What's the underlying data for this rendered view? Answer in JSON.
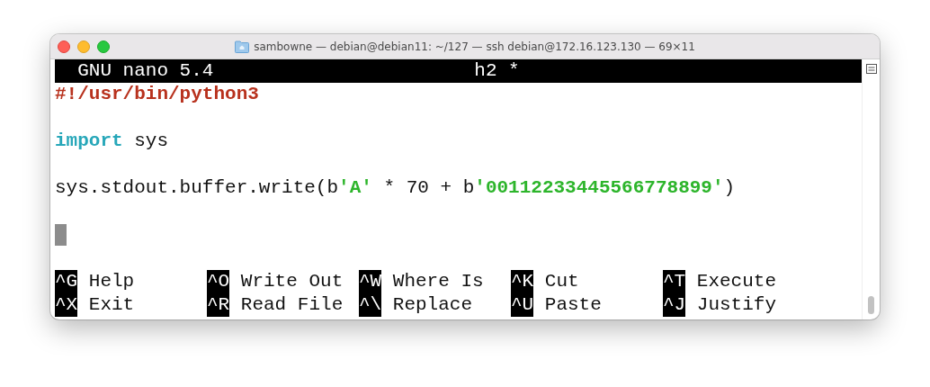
{
  "window": {
    "title": "sambowne — debian@debian11: ~/127 — ssh debian@172.16.123.130 — 69×11"
  },
  "header": {
    "app": "GNU nano 5.4",
    "filename": "h2 *"
  },
  "lines": [
    {
      "kind": "code",
      "tokens": [
        {
          "kind": "comment",
          "text": "#!/usr/bin/python3"
        }
      ]
    },
    {
      "kind": "blank"
    },
    {
      "kind": "code",
      "tokens": [
        {
          "kind": "keyword",
          "text": "import"
        },
        {
          "kind": "plain",
          "text": " sys"
        }
      ]
    },
    {
      "kind": "blank"
    },
    {
      "kind": "code",
      "tokens": [
        {
          "kind": "plain",
          "text": "sys.stdout.buffer.write(b"
        },
        {
          "kind": "string",
          "text": "'A'"
        },
        {
          "kind": "plain",
          "text": " * 70 + b"
        },
        {
          "kind": "string",
          "text": "'00112233445566778899'"
        },
        {
          "kind": "plain",
          "text": ")"
        }
      ]
    },
    {
      "kind": "blank"
    },
    {
      "kind": "cursor"
    },
    {
      "kind": "blank"
    }
  ],
  "shortcuts": [
    [
      {
        "key": "^G",
        "label": "Help"
      },
      {
        "key": "^O",
        "label": "Write Out"
      },
      {
        "key": "^W",
        "label": "Where Is"
      },
      {
        "key": "^K",
        "label": "Cut"
      },
      {
        "key": "^T",
        "label": "Execute"
      }
    ],
    [
      {
        "key": "^X",
        "label": "Exit"
      },
      {
        "key": "^R",
        "label": "Read File"
      },
      {
        "key": "^\\",
        "label": "Replace"
      },
      {
        "key": "^U",
        "label": "Paste"
      },
      {
        "key": "^J",
        "label": "Justify"
      }
    ]
  ]
}
